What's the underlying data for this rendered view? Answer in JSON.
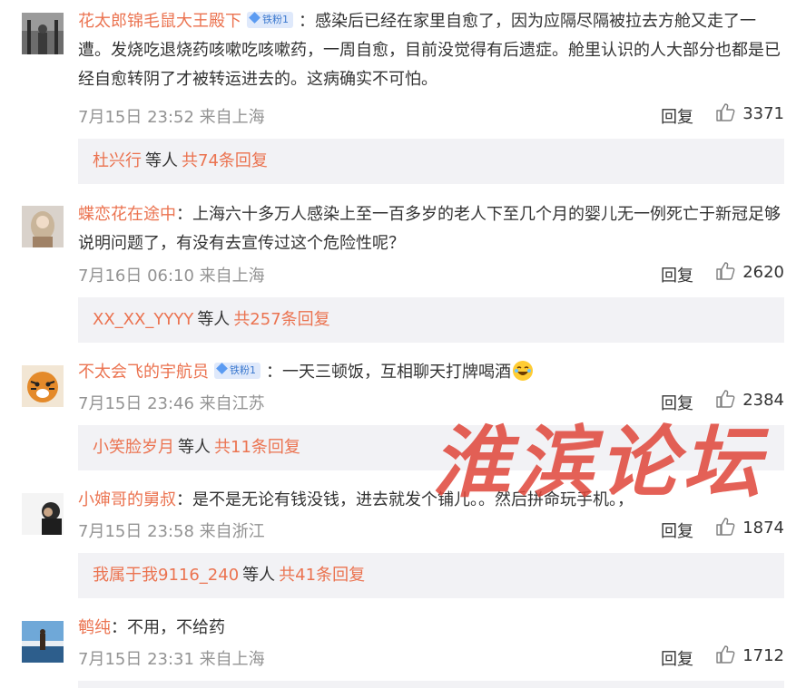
{
  "comments": [
    {
      "username": "花太郎锦毛鼠大王殿下",
      "badge": "铁粉1",
      "text": "感染后已经在家里自愈了，因为应隔尽隔被拉去方舱又走了一遭。发烧吃退烧药咳嗽吃咳嗽药，一周自愈，目前没觉得有后遗症。舱里认识的人大部分也都是已经自愈转阴了才被转运进去的。这病确实不可怕。",
      "time": "7月15日 23:52 来自上海",
      "reply_label": "回复",
      "likes": "3371",
      "sub_user": "杜兴行",
      "sub_etc": "等人",
      "sub_count": "共74条回复"
    },
    {
      "username": "蝶恋花在途中",
      "badge": "",
      "text": "上海六十多万人感染上至一百多岁的老人下至几个月的婴儿无一例死亡于新冠足够说明问题了，有没有去宣传过这个危险性呢？",
      "time": "7月16日 06:10 来自上海",
      "reply_label": "回复",
      "likes": "2620",
      "sub_user": "XX_XX_YYYY",
      "sub_etc": "等人",
      "sub_count": "共257条回复"
    },
    {
      "username": "不太会飞的宇航员",
      "badge": "铁粉1",
      "text": "一天三顿饭，互相聊天打牌喝酒",
      "time": "7月15日 23:46 来自江苏",
      "reply_label": "回复",
      "likes": "2384",
      "sub_user": "小笑脸岁月",
      "sub_etc": "等人",
      "sub_count": "共11条回复"
    },
    {
      "username": "小婶哥的舅叔",
      "badge": "",
      "text": "是不是无论有钱没钱，进去就发个铺儿。。然后拼命玩手机。，",
      "time": "7月15日 23:58 来自浙江",
      "reply_label": "回复",
      "likes": "1874",
      "sub_user": "我属于我9116_240",
      "sub_etc": "等人",
      "sub_count": "共41条回复"
    },
    {
      "username": "鹌纯",
      "badge": "",
      "text": "不用，不给药",
      "time": "7月15日 23:31 来自上海",
      "reply_label": "回复",
      "likes": "1712"
    }
  ],
  "colon": "：",
  "watermark": "淮滨论坛",
  "colors": {
    "username": "#eb7350",
    "meta": "#939393",
    "subbox_bg": "#f2f2f5",
    "badge_bg": "#dfe9fb"
  }
}
